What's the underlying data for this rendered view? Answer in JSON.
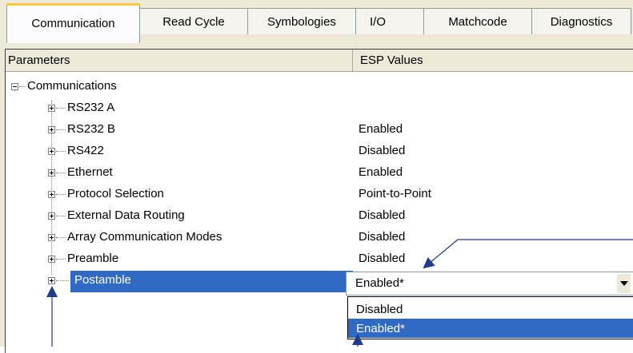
{
  "tabs": [
    {
      "label": "Communication",
      "active": true
    },
    {
      "label": "Read Cycle",
      "active": false
    },
    {
      "label": "Symbologies",
      "active": false
    },
    {
      "label": "I/O",
      "active": false
    },
    {
      "label": "Matchcode",
      "active": false
    },
    {
      "label": "Diagnostics",
      "active": false
    }
  ],
  "columns": {
    "parameters": "Parameters",
    "values": "ESP Values"
  },
  "tree": {
    "root": {
      "label": "Communications",
      "expanded": true
    },
    "items": [
      {
        "label": "RS232 A",
        "value": ""
      },
      {
        "label": "RS232 B",
        "value": "Enabled"
      },
      {
        "label": "RS422",
        "value": "Disabled"
      },
      {
        "label": "Ethernet",
        "value": "Enabled"
      },
      {
        "label": "Protocol Selection",
        "value": "Point-to-Point"
      },
      {
        "label": "External Data Routing",
        "value": "Disabled"
      },
      {
        "label": "Array Communication Modes",
        "value": "Disabled"
      },
      {
        "label": "Preamble",
        "value": "Disabled"
      },
      {
        "label": "Postamble",
        "value": "Enabled*",
        "selected": true
      }
    ]
  },
  "dropdown": {
    "current": "Enabled*",
    "options": [
      {
        "label": "Disabled",
        "highlighted": false
      },
      {
        "label": "Enabled*",
        "highlighted": true
      }
    ]
  },
  "colors": {
    "selection": "#316ac5",
    "tab_highlight": "#ffc83c",
    "callout": "#1f3b8c"
  }
}
